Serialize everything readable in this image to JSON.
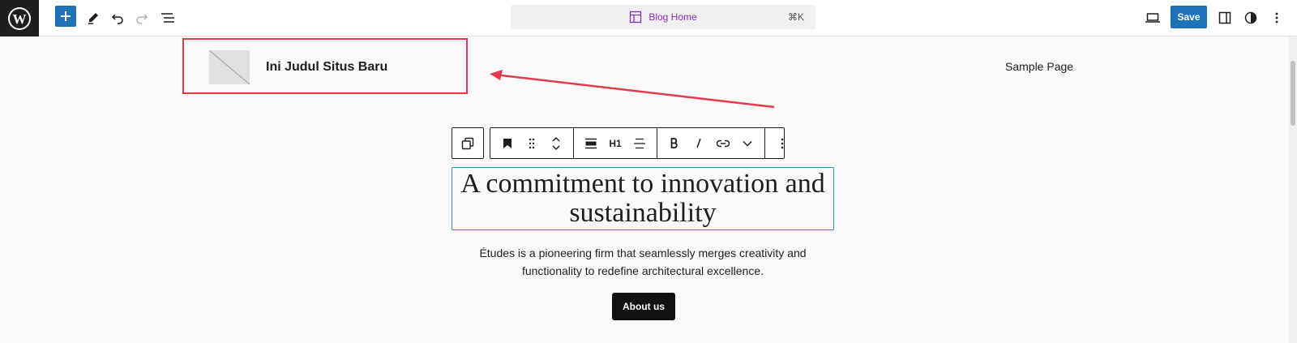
{
  "topbar": {
    "document_title": "Blog Home",
    "command_shortcut": "⌘K",
    "save_label": "Save"
  },
  "header": {
    "site_title": "Ini Judul Situs Baru",
    "nav_link": "Sample Page"
  },
  "block_toolbar": {
    "heading_level": "H1"
  },
  "content": {
    "heading": "A commitment to innovation and sustainability",
    "description": "Études is a pioneering firm that seamlessly merges creativity and functionality to redefine architectural excellence.",
    "button_label": "About us"
  },
  "colors": {
    "accent": "#1d72b8",
    "highlight": "#e23a4b",
    "command_title": "#8a2fb8"
  }
}
